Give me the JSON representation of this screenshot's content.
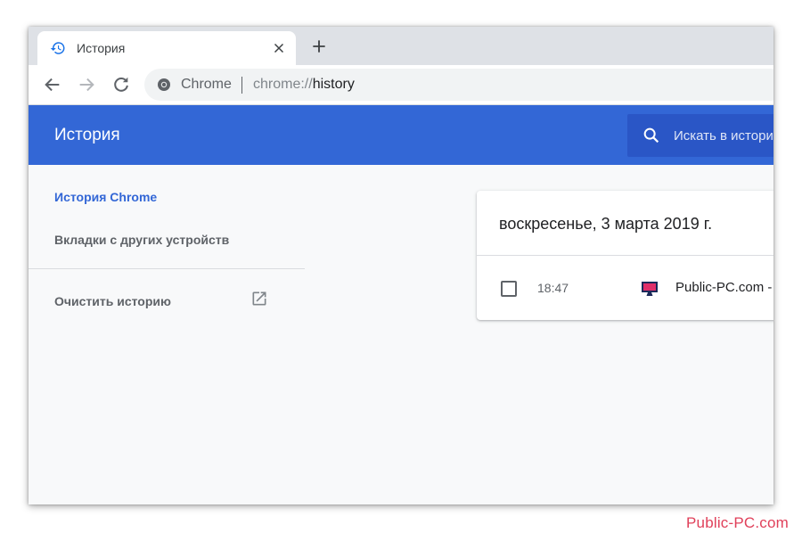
{
  "tab": {
    "title": "История"
  },
  "omnibox": {
    "chip": "Chrome",
    "url_scheme": "chrome://",
    "url_host": "history"
  },
  "header": {
    "title": "История",
    "search_placeholder": "Искать в истории"
  },
  "sidebar": {
    "items": [
      {
        "label": "История Chrome",
        "active": true
      },
      {
        "label": "Вкладки с других устройств"
      },
      {
        "label": "Очистить историю"
      }
    ]
  },
  "history": {
    "date_heading": "воскресенье, 3 марта 2019 г.",
    "entries": [
      {
        "time": "18:47",
        "title": "Public-PC.com -"
      }
    ]
  },
  "watermark": "Public-PC.com",
  "colors": {
    "accent": "#3367d6",
    "search_bg": "#2a56c6",
    "watermark": "#e0405a"
  },
  "icons": [
    "history-icon",
    "close-icon",
    "plus-icon",
    "back-arrow-icon",
    "forward-arrow-icon",
    "reload-icon",
    "chrome-icon",
    "search-icon",
    "external-link-icon",
    "monitor-icon"
  ]
}
